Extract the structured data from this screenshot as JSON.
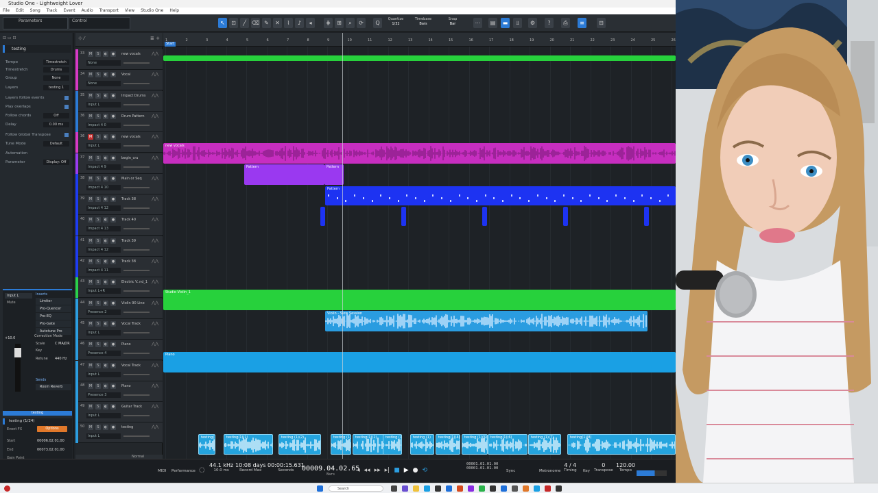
{
  "window": {
    "title": "Studio One - Lightweight Lover"
  },
  "menu": [
    "File",
    "Edit",
    "Song",
    "Track",
    "Event",
    "Audio",
    "Transport",
    "View",
    "Studio One",
    "Help"
  ],
  "toolbar": {
    "preset_left": "Parameters",
    "preset_right": "Control",
    "quantize_label": "Quantize",
    "quantize_value": "1/32",
    "timebase_label": "Timebase",
    "timebase_value": "Bars",
    "snap_label": "Snap",
    "snap_value": "Bar"
  },
  "inspector": {
    "track_name": "testing",
    "rows": [
      {
        "label": "Tempo",
        "value": "Timestretch"
      },
      {
        "label": "Timestretch",
        "value": "Drums"
      },
      {
        "label": "Group",
        "value": "None"
      },
      {
        "label": "Layers",
        "value": "testing 1"
      },
      {
        "label": "Layers follow events",
        "value": ""
      },
      {
        "label": "Play overlaps",
        "value": ""
      },
      {
        "label": "Follow chords",
        "value": "Off"
      },
      {
        "label": "Delay",
        "value": "0.00 ms"
      },
      {
        "label": "Follow Global Transpose",
        "value": ""
      },
      {
        "label": "Tune Mode",
        "value": "Default"
      },
      {
        "label": "Automation",
        "value": ""
      },
      {
        "label": "Parameter",
        "value": "Display: Off"
      }
    ],
    "channel": {
      "input": "Input L",
      "mode": "Mute",
      "gain": "+10.0",
      "inserts_label": "Inserts",
      "inserts": [
        "Limiter",
        "Pro-Quencer",
        "Pro-EQ",
        "Pro-Gate",
        "Autotune Pro"
      ],
      "correction_mode": "Correction Mode",
      "scale_label": "Scale",
      "scale_value": "C MAJOR",
      "key_label": "Key",
      "retune_label": "Retune",
      "retune_value": "440 Hz",
      "sends_label": "Sends",
      "sends": [
        "Room Reverb"
      ],
      "footer": "testing"
    },
    "event": {
      "title": "testing (1/24)",
      "event_label": "Event FX",
      "toggle": "Options",
      "start_label": "Start",
      "start_value": "00006.02.01.00",
      "end_label": "End",
      "end_value": "00073.02.01.00",
      "gain_label": "Gain Point"
    }
  },
  "tracklist": {
    "tracks": [
      {
        "num": "33",
        "name": "new vocals",
        "sub": "None",
        "color": "#d63ac6"
      },
      {
        "num": "34",
        "name": "Vocal",
        "sub": "None",
        "color": "#d63ac6"
      },
      {
        "num": "35",
        "name": "Impact Drums",
        "sub": "Input L",
        "color": "#2c7bd6"
      },
      {
        "num": "36",
        "name": "Drum Pattern",
        "sub": "Impact 4 0",
        "color": "#2c7bd6"
      },
      {
        "num": "36",
        "name": "new vocals",
        "sub": "Input L",
        "color": "#d63ac6",
        "rec": true
      },
      {
        "num": "37",
        "name": "begin_cru",
        "sub": "Impact 4 9",
        "color": "#9a3cf0"
      },
      {
        "num": "38",
        "name": "Main or Seq",
        "sub": "Impact 4 10",
        "color": "#1e3cf0"
      },
      {
        "num": "39",
        "name": "Track 38",
        "sub": "Impact 4 12",
        "color": "#1e3cf0"
      },
      {
        "num": "40",
        "name": "Track 40",
        "sub": "Impact 4 13",
        "color": "#1e3cf0"
      },
      {
        "num": "41",
        "name": "Track 39",
        "sub": "Impact 4 12",
        "color": "#1e3cf0"
      },
      {
        "num": "42",
        "name": "Track 38",
        "sub": "Impact 4 11",
        "color": "#1e3cf0"
      },
      {
        "num": "43",
        "name": "Electric V..nd_1",
        "sub": "Input L+R",
        "color": "#2ad04a"
      },
      {
        "num": "44",
        "name": "Violin 90 Line",
        "sub": "Presence 2",
        "color": "#2c9ee0"
      },
      {
        "num": "45",
        "name": "Vocal Track",
        "sub": "Input L",
        "color": "#2c9ee0"
      },
      {
        "num": "46",
        "name": "Piano",
        "sub": "Presence 4",
        "color": "#2c9ee0"
      },
      {
        "num": "47",
        "name": "Vocal Track",
        "sub": "Input L",
        "color": "#2c9ee0"
      },
      {
        "num": "48",
        "name": "Piano",
        "sub": "Presence 3",
        "color": "#2c9ee0"
      },
      {
        "num": "49",
        "name": "Guitar Track",
        "sub": "Input L",
        "color": "#2c9ee0"
      },
      {
        "num": "50",
        "name": "testing",
        "sub": "Input L",
        "color": "#2c9ee0"
      }
    ],
    "footer_label": "Normal"
  },
  "ruler": [
    "1",
    "2",
    "3",
    "4",
    "5",
    "6",
    "7",
    "8",
    "9",
    "10",
    "11",
    "12",
    "13",
    "14",
    "15",
    "16",
    "17",
    "18",
    "19",
    "20",
    "21",
    "22",
    "23",
    "24",
    "25",
    "26"
  ],
  "marker": "Start",
  "clips": [
    {
      "name": "",
      "color": "#27d13c"
    },
    {
      "name": "new vocals",
      "color": "#c72ec0"
    },
    {
      "name": "Pattern",
      "color": "#9a39f0"
    },
    {
      "name": "Pattern",
      "color": "#9a39f0"
    },
    {
      "name": "Pattern",
      "color": "#1d33f2"
    },
    {
      "name": "Studio Violin_1",
      "color": "#27d13c"
    },
    {
      "name": "Violin - Slow Session",
      "color": "#2a9ce0"
    },
    {
      "name": "Piano",
      "color": "#1aa0e4"
    }
  ],
  "bottom_clips": [
    "testing(1)",
    "testing(1)(1)",
    "testing (1)(2)",
    "testing (1)(3)",
    "testing(1)(2)",
    "testing (1)",
    "testing (1)",
    "testing(1)(4)",
    "testing (1)(5)",
    "testing(1)(6)",
    "testing (1)(7)",
    "testing(1)(8)"
  ],
  "transport": {
    "midi_label": "MIDI",
    "performance_label": "Performance",
    "sample_rate": "44.1 kHz",
    "sr_sub": "10.0 ms",
    "days": "10:08 days",
    "days_sub": "Record Max",
    "seconds": "00:00:15.631",
    "seconds_sub": "Seconds",
    "position": "00009.04.02.65",
    "position_sub": "Bars",
    "loop_start": "00001.01.01.00",
    "loop_end": "00001.01.01.00",
    "sync_label": "Sync",
    "metronome_label": "Metronome",
    "timing_label": "Timing",
    "key_label": "Key",
    "time_sig": "4 / 4",
    "transpose": "0",
    "transpose_label": "Transpose",
    "tempo": "120.00",
    "tempo_label": "Tempo"
  },
  "taskbar": {
    "search": "Search",
    "date_time": ""
  }
}
